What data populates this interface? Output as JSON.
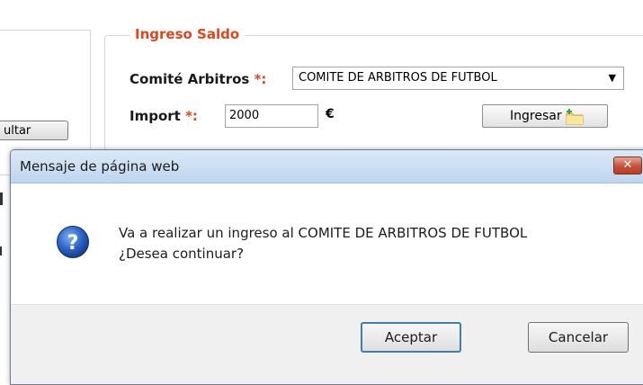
{
  "page": {
    "left_button_label": "ultar",
    "fieldset": {
      "legend": "Ingreso Saldo",
      "comite_label": "Comité Arbitros",
      "comite_required": "*:",
      "comite_value": "COMITE DE ARBITROS DE FUTBOL",
      "import_label": "Import",
      "import_required": "*:",
      "import_value": "2000",
      "currency": "€",
      "ingresar_label": "Ingresar"
    }
  },
  "dialog": {
    "title": "Mensaje de página web",
    "close_label": "✕",
    "message_line1": "Va a realizar un ingreso al COMITE DE ARBITROS DE FUTBOL",
    "message_line2": "¿Desea continuar?",
    "accept_label": "Aceptar",
    "cancel_label": "Cancelar"
  },
  "colors": {
    "accent_orange": "#e0451b",
    "titlebar_blue": "#bed5ee",
    "close_red": "#c6523a",
    "focus_blue": "#3c7fb1"
  },
  "icons": [
    "chevron-down-icon",
    "folder-add-icon",
    "question-icon",
    "close-icon"
  ]
}
